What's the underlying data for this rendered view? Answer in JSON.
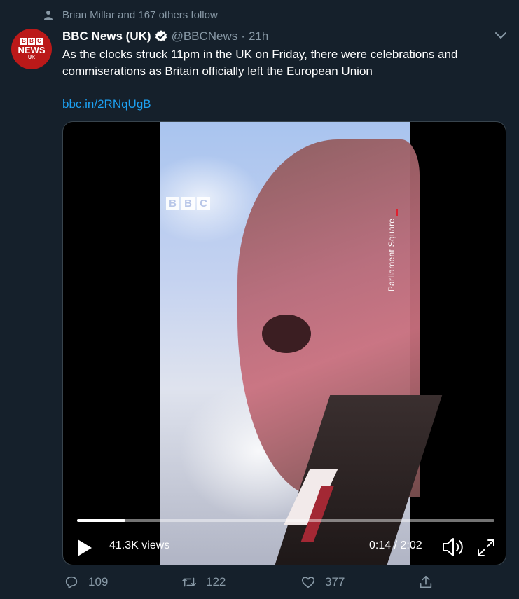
{
  "social_context": {
    "text": "Brian Millar and 167 others follow",
    "icon": "person-icon"
  },
  "avatar": {
    "letters": [
      "B",
      "B",
      "C"
    ],
    "news": "NEWS",
    "region": "UK"
  },
  "tweet": {
    "display_name": "BBC News (UK)",
    "handle": "@BBCNews",
    "separator": "·",
    "time": "21h",
    "text": "As the clocks struck 11pm in the UK on Friday, there were celebrations and commiserations as Britain officially left the European Union",
    "link": "bbc.in/2RNqUgB"
  },
  "video": {
    "watermark_letters": [
      "B",
      "B",
      "C"
    ],
    "location": "Parliament Square",
    "views": "41.3K views",
    "timecode": "0:14 / 2:02",
    "progress": 0.115
  },
  "actions": {
    "replies": "109",
    "retweets": "122",
    "likes": "377"
  },
  "colors": {
    "background": "#15202b",
    "secondary_text": "#8899a6",
    "link": "#1da1f2",
    "brand_red": "#bb1919",
    "border": "#38444d"
  }
}
